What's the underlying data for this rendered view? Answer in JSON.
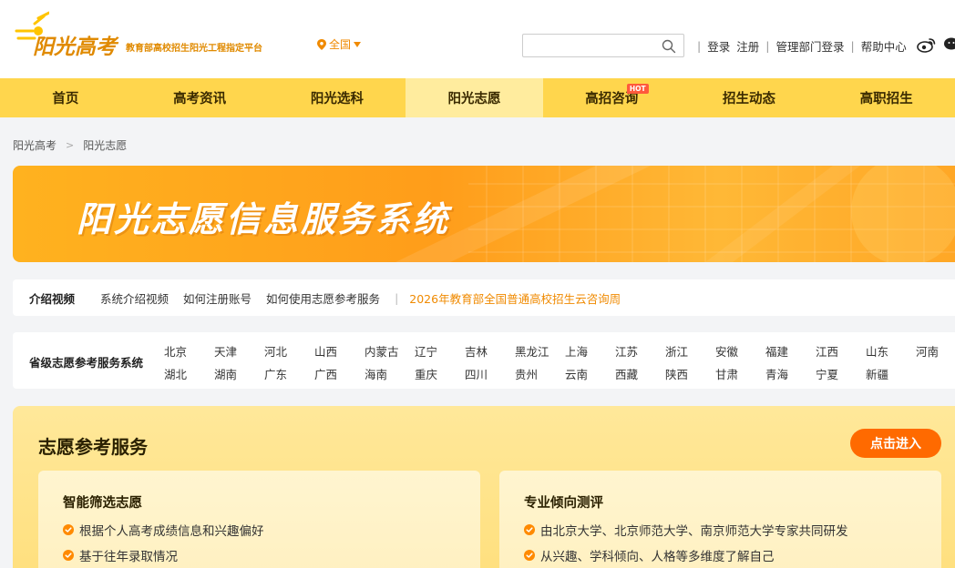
{
  "header": {
    "logo_main": "阳光高考",
    "logo_sub": "教育部高校招生阳光工程指定平台",
    "location": "全国",
    "search_placeholder": "",
    "links": {
      "login": "登录",
      "register": "注册",
      "admin_login": "管理部门登录",
      "help": "帮助中心"
    }
  },
  "nav": {
    "items": [
      "首页",
      "高考资讯",
      "阳光选科",
      "阳光志愿",
      "高招咨询",
      "招生动态",
      "高职招生"
    ],
    "active": "阳光志愿",
    "hot_badge": "HOT"
  },
  "breadcrumb": {
    "home": "阳光高考",
    "current": "阳光志愿"
  },
  "banner": {
    "title": "阳光志愿信息服务系统"
  },
  "intro": {
    "label": "介绍视频",
    "links": [
      "系统介绍视频",
      "如何注册账号",
      "如何使用志愿参考服务"
    ],
    "highlight": "2026年教育部全国普通高校招生云咨询周"
  },
  "provinces": {
    "label": "省级志愿参考服务系统",
    "row1": [
      "北京",
      "天津",
      "河北",
      "山西",
      "内蒙古",
      "辽宁",
      "吉林",
      "黑龙江",
      "上海",
      "江苏",
      "浙江",
      "安徽",
      "福建",
      "江西",
      "山东",
      "河南"
    ],
    "row2": [
      "湖北",
      "湖南",
      "广东",
      "广西",
      "海南",
      "重庆",
      "四川",
      "贵州",
      "云南",
      "西藏",
      "陕西",
      "甘肃",
      "青海",
      "宁夏",
      "新疆"
    ]
  },
  "service": {
    "title": "志愿参考服务",
    "enter_button": "点击进入",
    "cards": [
      {
        "title": "智能筛选志愿",
        "items": [
          "根据个人高考成绩信息和兴趣偏好",
          "基于往年录取情况"
        ]
      },
      {
        "title": "专业倾向测评",
        "items": [
          "由北京大学、北京师范大学、南京师范大学专家共同研发",
          "从兴趣、学科倾向、人格等多维度了解自己"
        ]
      }
    ]
  },
  "colors": {
    "accent": "#ffd64d",
    "nav_active": "#ffec9e",
    "orange": "#f08a00",
    "button": "#ff6a00",
    "hot": "#ff5a3c"
  }
}
